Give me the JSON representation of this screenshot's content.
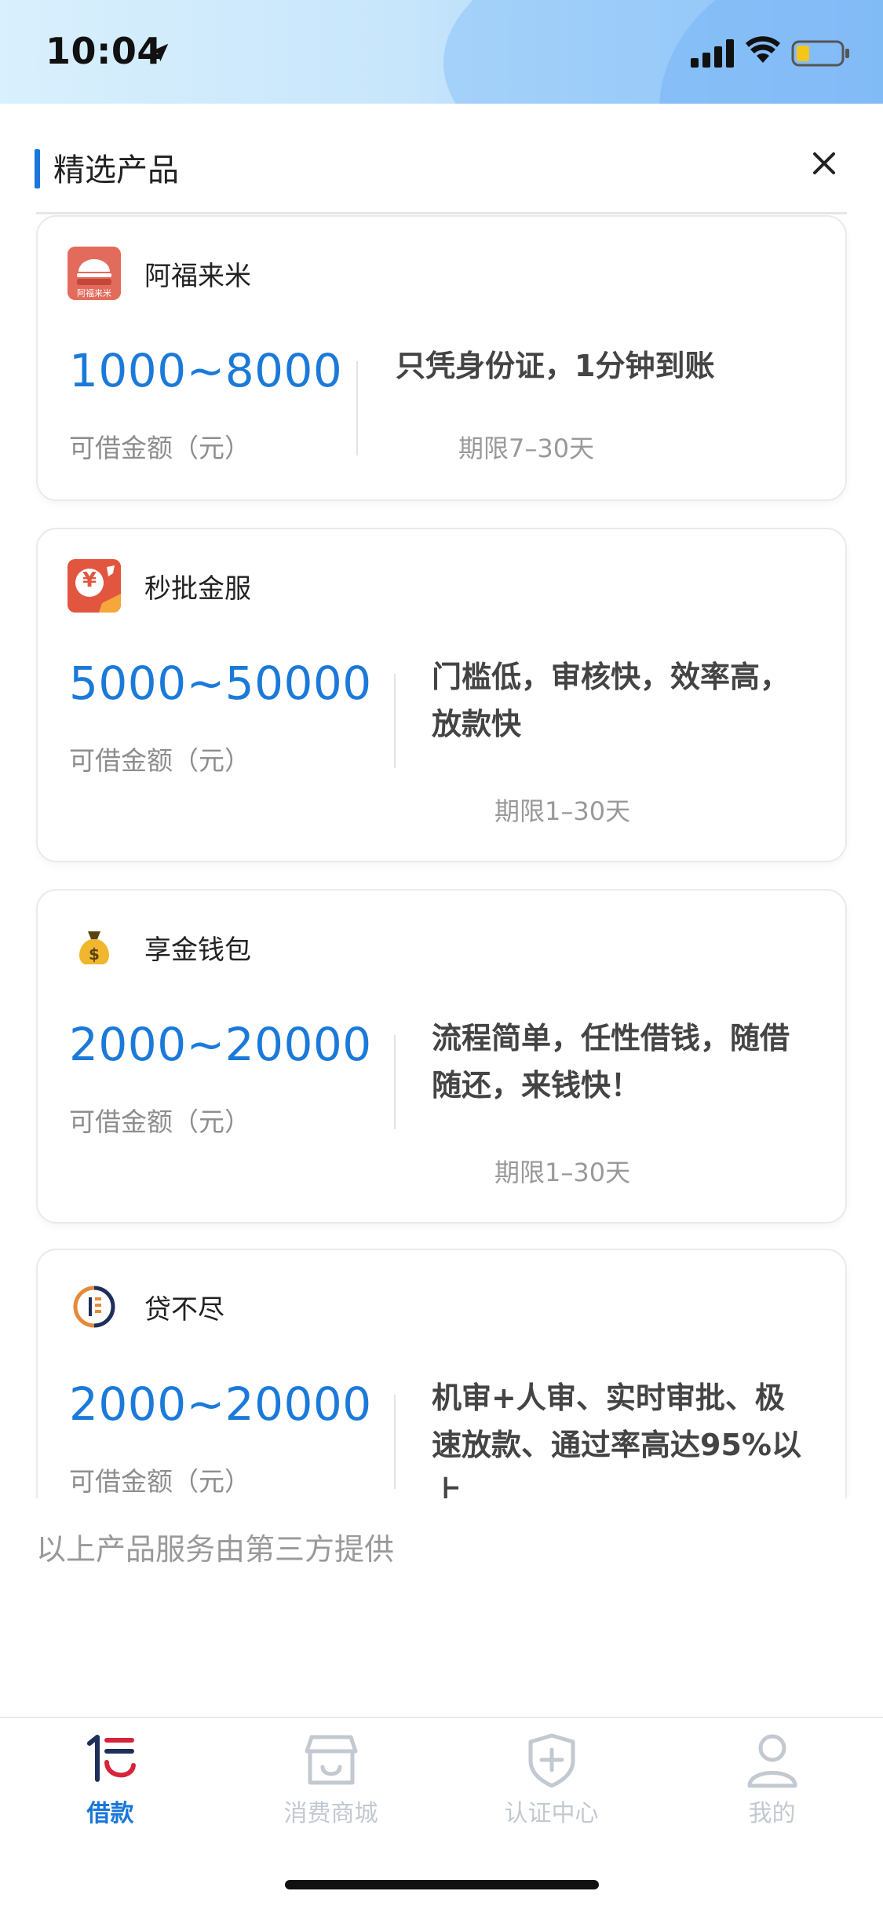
{
  "status_bar": {
    "time": "10:04"
  },
  "header": {
    "title": "精选产品"
  },
  "products": [
    {
      "name": "阿福来米",
      "logo_text": "阿福来米",
      "amount": "1000~8000",
      "amount_label": "可借金额（元）",
      "desc_lines": [
        "只凭身份证，1分钟到账"
      ],
      "term": "期限7–30天"
    },
    {
      "name": "秒批金服",
      "logo_text": "¥",
      "amount": "5000~50000",
      "amount_label": "可借金额（元）",
      "desc_lines": [
        "门槛低，审核快，效率高，",
        "放款快"
      ],
      "term": "期限1–30天"
    },
    {
      "name": "享金钱包",
      "amount": "2000~20000",
      "amount_label": "可借金额（元）",
      "desc_lines": [
        "流程简单，任性借钱，随借",
        "随还，来钱快！"
      ],
      "term": "期限1–30天"
    },
    {
      "name": "贷不尽",
      "amount": "2000~20000",
      "amount_label": "可借金额（元）",
      "desc_lines": [
        "机审+人审、实时审批、极",
        "速放款、通过率高达95%以",
        "上"
      ],
      "term": ""
    }
  ],
  "footer_note": "以上产品服务由第三方提供",
  "tabs": [
    {
      "label": "借款",
      "icon": "borrow-icon",
      "active": true
    },
    {
      "label": "消费商城",
      "icon": "store-icon",
      "active": false
    },
    {
      "label": "认证中心",
      "icon": "shield-plus-icon",
      "active": false
    },
    {
      "label": "我的",
      "icon": "user-icon",
      "active": false
    }
  ],
  "colors": {
    "accent": "#1b7ad9",
    "tab_inactive": "#c3c9d1"
  }
}
